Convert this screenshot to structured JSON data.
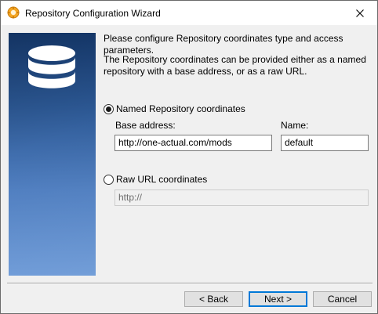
{
  "window": {
    "title": "Repository Configuration Wizard",
    "app_icon": "wizard-app-icon",
    "close_icon": "close-icon"
  },
  "banner": {
    "icon": "database-icon",
    "colors": {
      "top": "#173d74",
      "bottom": "#6a98d6"
    }
  },
  "intro": {
    "line1": "Please configure Repository coordinates type and access parameters.",
    "line2": "The Repository coordinates can be provided either as a named repository with a base address, or as a raw URL."
  },
  "named": {
    "label": "Named Repository coordinates",
    "selected": true,
    "base_address_label": "Base address:",
    "base_address_value": "http://one-actual.com/mods",
    "name_label": "Name:",
    "name_value": "default"
  },
  "raw": {
    "label": "Raw URL coordinates",
    "selected": false,
    "url_value": "http://"
  },
  "buttons": {
    "back": "< Back",
    "next": "Next >",
    "cancel": "Cancel"
  },
  "colors": {
    "accent": "#0078d7",
    "dialog_bg": "#f0f0f0"
  }
}
